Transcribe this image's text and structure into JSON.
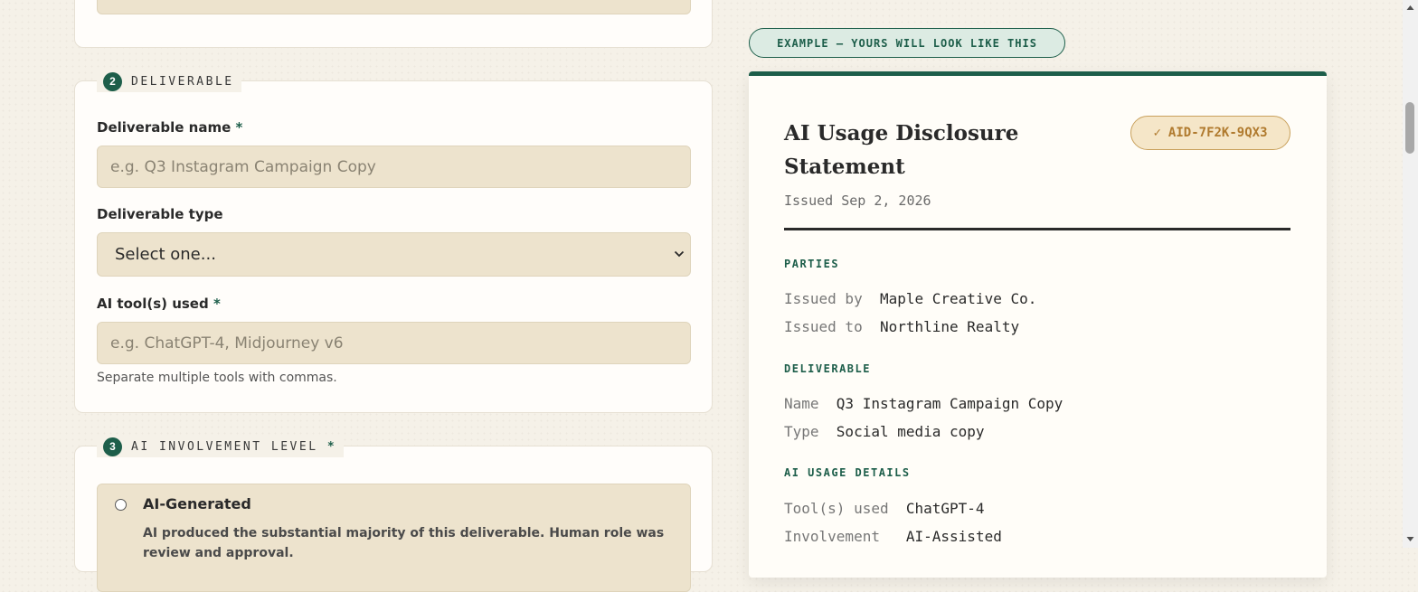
{
  "form": {
    "section2": {
      "number": "2",
      "title": "DELIVERABLE"
    },
    "deliverable_name": {
      "label": "Deliverable name",
      "required": "*",
      "placeholder": "e.g. Q3 Instagram Campaign Copy"
    },
    "deliverable_type": {
      "label": "Deliverable type",
      "selected": "Select one..."
    },
    "ai_tools": {
      "label": "AI tool(s) used",
      "required": "*",
      "placeholder": "e.g. ChatGPT-4, Midjourney v6",
      "hint": "Separate multiple tools with commas."
    },
    "section3": {
      "number": "3",
      "title": "AI INVOLVEMENT LEVEL",
      "required": "*"
    },
    "involvement_options": [
      {
        "title": "AI-Generated",
        "description": "AI produced the substantial majority of this deliverable. Human role was review and approval."
      }
    ]
  },
  "preview": {
    "pill": "EXAMPLE — YOURS WILL LOOK LIKE THIS",
    "title": "AI Usage Disclosure Statement",
    "badge_check": "✓",
    "badge_id": "AID-7F2K-9QX3",
    "issued": "Issued Sep 2, 2026",
    "parties": {
      "heading": "PARTIES",
      "issued_by_label": "Issued by",
      "issued_by": "Maple Creative Co.",
      "issued_to_label": "Issued to",
      "issued_to": "Northline Realty"
    },
    "deliverable": {
      "heading": "DELIVERABLE",
      "name_label": "Name",
      "name": "Q3 Instagram Campaign Copy",
      "type_label": "Type",
      "type": "Social media copy"
    },
    "ai_usage": {
      "heading": "AI USAGE DETAILS",
      "tools_label": "Tool(s) used",
      "tools": "ChatGPT-4",
      "involvement_label": "Involvement",
      "involvement": "AI-Assisted"
    }
  },
  "colors": {
    "accent": "#1d5e4a",
    "input_bg": "#ede3cd",
    "badge_text": "#b07a2e",
    "page_bg": "#f5f1e8"
  }
}
